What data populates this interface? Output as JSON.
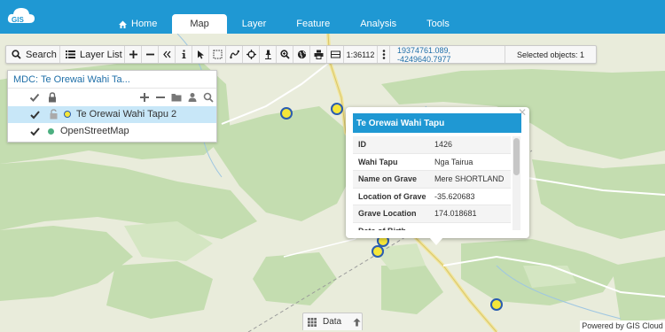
{
  "app": {
    "logo_text": "GIS"
  },
  "nav": {
    "tabs": [
      {
        "label": "Home",
        "active": false
      },
      {
        "label": "Map",
        "active": true
      },
      {
        "label": "Layer",
        "active": false
      },
      {
        "label": "Feature",
        "active": false
      },
      {
        "label": "Analysis",
        "active": false
      },
      {
        "label": "Tools",
        "active": false
      }
    ]
  },
  "toolbar": {
    "search_label": "Search",
    "layer_list_label": "Layer List",
    "scale": "1:36112",
    "coordinates": "19374761.089, -4249640.7977",
    "selected_objects": "Selected objects: 1",
    "icons": [
      "plus-icon",
      "minus-icon",
      "collapse-icon",
      "info-icon",
      "pointer-icon",
      "select-rect-icon",
      "measure-icon",
      "move-icon",
      "pin-icon",
      "zoom-icon",
      "globe-icon",
      "print-icon",
      "scalebar-icon",
      "more-icon"
    ]
  },
  "layer_panel": {
    "title": "MDC: Te Orewai Wahi Ta...",
    "layers": [
      {
        "name": "Te Orewai Wahi Tapu 2",
        "selected": true,
        "visible": true,
        "dot_color": "#f5e63a"
      },
      {
        "name": "OpenStreetMap",
        "selected": false,
        "visible": true,
        "dot_color": "#4caf80"
      }
    ]
  },
  "popup": {
    "title": "Te Orewai Wahi Tapu",
    "rows": [
      {
        "key": "ID",
        "value": "1426"
      },
      {
        "key": "Wahi Tapu",
        "value": "Nga Tairua"
      },
      {
        "key": "Name on Grave",
        "value": "Mere SHORTLAND"
      },
      {
        "key": "Location of Grave",
        "value": "-35.620683"
      },
      {
        "key": "Grave Location",
        "value": "174.018681"
      },
      {
        "key": "Date of Birth",
        "value": ""
      }
    ]
  },
  "data_bar": {
    "label": "Data"
  },
  "footer": {
    "powered_by": "Powered by GIS Cloud"
  },
  "colors": {
    "header": "#1f98d3",
    "accent_text": "#1f6fa8",
    "marker_fill": "#f5e63a",
    "marker_stroke": "#2a5db0"
  }
}
